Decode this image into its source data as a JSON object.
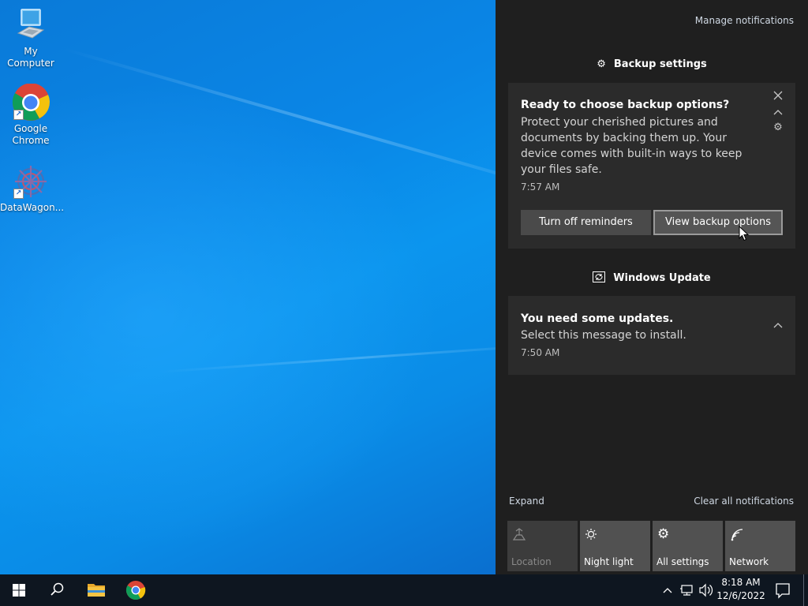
{
  "desktop": {
    "icons": [
      {
        "label": "My Computer",
        "icon": "computer-icon"
      },
      {
        "label": "Google Chrome",
        "icon": "chrome-icon"
      },
      {
        "label": "DataWagon...",
        "icon": "datawagon-icon"
      }
    ]
  },
  "action_center": {
    "manage_notifications": "Manage notifications",
    "backup": {
      "header": "Backup settings",
      "title": "Ready to choose backup options?",
      "body": "Protect your cherished pictures and documents by backing them up. Your device comes with built-in ways to keep your files safe.",
      "time": "7:57 AM",
      "button_turn_off": "Turn off reminders",
      "button_view": "View backup options"
    },
    "update": {
      "header": "Windows Update",
      "title": "You need some updates.",
      "body": "Select this message to install.",
      "time": "7:50 AM"
    },
    "expand": "Expand",
    "clear_all": "Clear all notifications",
    "quick_actions": [
      {
        "label": "Location",
        "icon": "location-icon",
        "disabled": true
      },
      {
        "label": "Night light",
        "icon": "night-light-icon",
        "disabled": false
      },
      {
        "label": "All settings",
        "icon": "settings-icon",
        "disabled": false
      },
      {
        "label": "Network",
        "icon": "network-icon",
        "disabled": false
      }
    ]
  },
  "taskbar": {
    "time": "8:18 AM",
    "date": "12/6/2022"
  },
  "colors": {
    "action_center_bg": "#1f1f1f",
    "toast_bg": "#2b2b2b",
    "taskbar_bg": "#0e1620",
    "accent": "#0a86e6"
  }
}
